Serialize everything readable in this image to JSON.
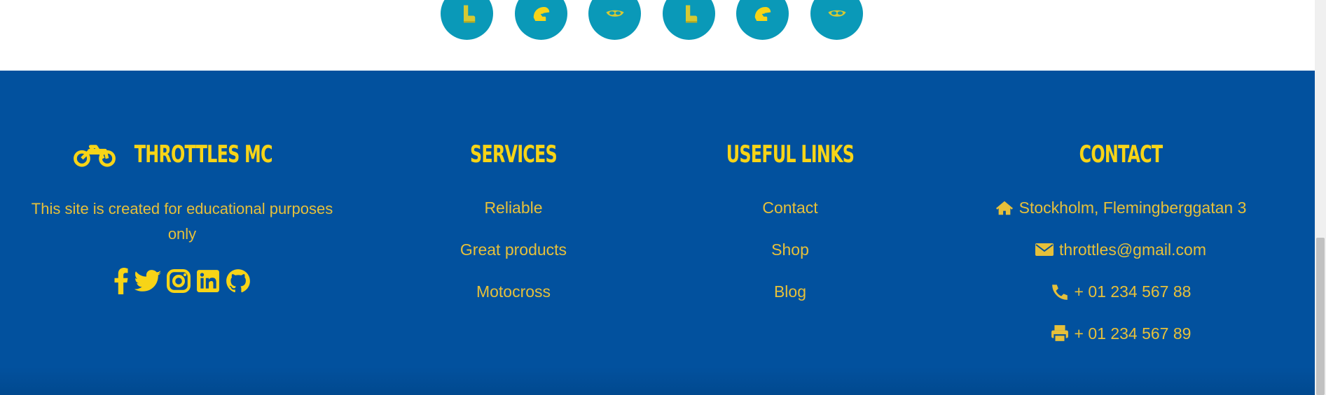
{
  "categories": [
    {
      "icon": "boot-icon"
    },
    {
      "icon": "helmet-icon"
    },
    {
      "icon": "goggles-icon"
    },
    {
      "icon": "boot-icon"
    },
    {
      "icon": "helmet-icon"
    },
    {
      "icon": "goggles-icon"
    }
  ],
  "brand": {
    "name": "THROTTLES MC",
    "icon": "motorcycle-icon",
    "description": "This site is created for educational purposes only"
  },
  "socials": [
    "facebook-icon",
    "twitter-icon",
    "instagram-icon",
    "linkedin-icon",
    "github-icon"
  ],
  "services": {
    "heading": "SERVICES",
    "items": [
      "Reliable",
      "Great products",
      "Motocross"
    ]
  },
  "useful_links": {
    "heading": "USEFUL LINKS",
    "items": [
      "Contact",
      "Shop",
      "Blog"
    ]
  },
  "contact": {
    "heading": "CONTACT",
    "address": "Stockholm, Flemingberggatan 3",
    "email": "throttles@gmail.com",
    "phone": "+ 01 234 567 88",
    "fax": "+ 01 234 567 89"
  },
  "colors": {
    "footer_bg": "#02519e",
    "heading": "#f7d417",
    "text": "#e6c03a",
    "circle": "#0a99b8"
  }
}
